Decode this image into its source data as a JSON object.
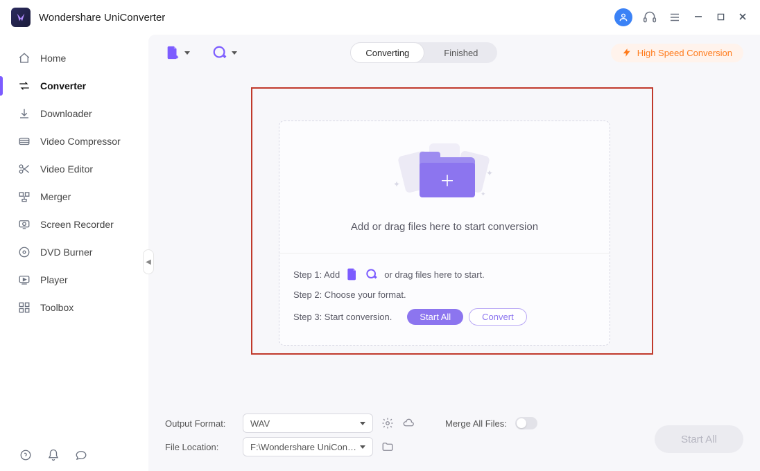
{
  "app": {
    "title": "Wondershare UniConverter"
  },
  "sidebar": {
    "items": [
      {
        "label": "Home"
      },
      {
        "label": "Converter"
      },
      {
        "label": "Downloader"
      },
      {
        "label": "Video Compressor"
      },
      {
        "label": "Video Editor"
      },
      {
        "label": "Merger"
      },
      {
        "label": "Screen Recorder"
      },
      {
        "label": "DVD Burner"
      },
      {
        "label": "Player"
      },
      {
        "label": "Toolbox"
      }
    ]
  },
  "topbar": {
    "tabs": {
      "converting": "Converting",
      "finished": "Finished"
    },
    "high_speed": "High Speed Conversion"
  },
  "drop": {
    "headline": "Add or drag files here to start conversion",
    "step1_prefix": "Step 1: Add",
    "step1_suffix": "or drag files here to start.",
    "step2": "Step 2: Choose your format.",
    "step3": "Step 3: Start conversion.",
    "start_all_label": "Start All",
    "convert_label": "Convert"
  },
  "footer": {
    "output_format_label": "Output Format:",
    "output_format_value": "WAV",
    "file_location_label": "File Location:",
    "file_location_value": "F:\\Wondershare UniConverter",
    "merge_label": "Merge All Files:",
    "start_all": "Start All"
  }
}
